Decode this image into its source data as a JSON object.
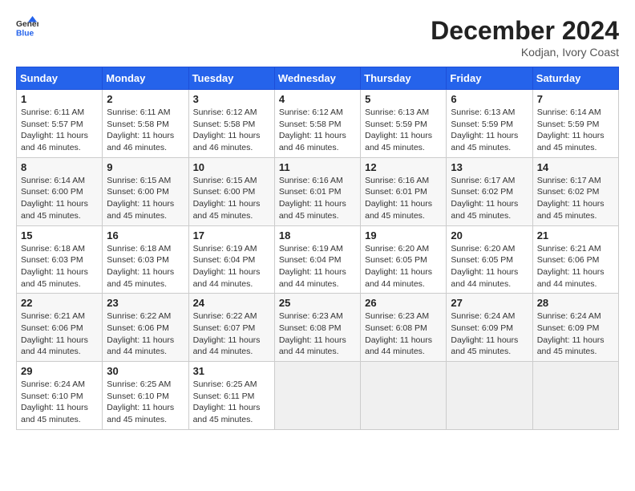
{
  "header": {
    "logo_line1": "General",
    "logo_line2": "Blue",
    "month": "December 2024",
    "location": "Kodjan, Ivory Coast"
  },
  "weekdays": [
    "Sunday",
    "Monday",
    "Tuesday",
    "Wednesday",
    "Thursday",
    "Friday",
    "Saturday"
  ],
  "weeks": [
    [
      {
        "day": "1",
        "info": "Sunrise: 6:11 AM\nSunset: 5:57 PM\nDaylight: 11 hours\nand 46 minutes."
      },
      {
        "day": "2",
        "info": "Sunrise: 6:11 AM\nSunset: 5:58 PM\nDaylight: 11 hours\nand 46 minutes."
      },
      {
        "day": "3",
        "info": "Sunrise: 6:12 AM\nSunset: 5:58 PM\nDaylight: 11 hours\nand 46 minutes."
      },
      {
        "day": "4",
        "info": "Sunrise: 6:12 AM\nSunset: 5:58 PM\nDaylight: 11 hours\nand 46 minutes."
      },
      {
        "day": "5",
        "info": "Sunrise: 6:13 AM\nSunset: 5:59 PM\nDaylight: 11 hours\nand 45 minutes."
      },
      {
        "day": "6",
        "info": "Sunrise: 6:13 AM\nSunset: 5:59 PM\nDaylight: 11 hours\nand 45 minutes."
      },
      {
        "day": "7",
        "info": "Sunrise: 6:14 AM\nSunset: 5:59 PM\nDaylight: 11 hours\nand 45 minutes."
      }
    ],
    [
      {
        "day": "8",
        "info": "Sunrise: 6:14 AM\nSunset: 6:00 PM\nDaylight: 11 hours\nand 45 minutes."
      },
      {
        "day": "9",
        "info": "Sunrise: 6:15 AM\nSunset: 6:00 PM\nDaylight: 11 hours\nand 45 minutes."
      },
      {
        "day": "10",
        "info": "Sunrise: 6:15 AM\nSunset: 6:00 PM\nDaylight: 11 hours\nand 45 minutes."
      },
      {
        "day": "11",
        "info": "Sunrise: 6:16 AM\nSunset: 6:01 PM\nDaylight: 11 hours\nand 45 minutes."
      },
      {
        "day": "12",
        "info": "Sunrise: 6:16 AM\nSunset: 6:01 PM\nDaylight: 11 hours\nand 45 minutes."
      },
      {
        "day": "13",
        "info": "Sunrise: 6:17 AM\nSunset: 6:02 PM\nDaylight: 11 hours\nand 45 minutes."
      },
      {
        "day": "14",
        "info": "Sunrise: 6:17 AM\nSunset: 6:02 PM\nDaylight: 11 hours\nand 45 minutes."
      }
    ],
    [
      {
        "day": "15",
        "info": "Sunrise: 6:18 AM\nSunset: 6:03 PM\nDaylight: 11 hours\nand 45 minutes."
      },
      {
        "day": "16",
        "info": "Sunrise: 6:18 AM\nSunset: 6:03 PM\nDaylight: 11 hours\nand 45 minutes."
      },
      {
        "day": "17",
        "info": "Sunrise: 6:19 AM\nSunset: 6:04 PM\nDaylight: 11 hours\nand 44 minutes."
      },
      {
        "day": "18",
        "info": "Sunrise: 6:19 AM\nSunset: 6:04 PM\nDaylight: 11 hours\nand 44 minutes."
      },
      {
        "day": "19",
        "info": "Sunrise: 6:20 AM\nSunset: 6:05 PM\nDaylight: 11 hours\nand 44 minutes."
      },
      {
        "day": "20",
        "info": "Sunrise: 6:20 AM\nSunset: 6:05 PM\nDaylight: 11 hours\nand 44 minutes."
      },
      {
        "day": "21",
        "info": "Sunrise: 6:21 AM\nSunset: 6:06 PM\nDaylight: 11 hours\nand 44 minutes."
      }
    ],
    [
      {
        "day": "22",
        "info": "Sunrise: 6:21 AM\nSunset: 6:06 PM\nDaylight: 11 hours\nand 44 minutes."
      },
      {
        "day": "23",
        "info": "Sunrise: 6:22 AM\nSunset: 6:06 PM\nDaylight: 11 hours\nand 44 minutes."
      },
      {
        "day": "24",
        "info": "Sunrise: 6:22 AM\nSunset: 6:07 PM\nDaylight: 11 hours\nand 44 minutes."
      },
      {
        "day": "25",
        "info": "Sunrise: 6:23 AM\nSunset: 6:08 PM\nDaylight: 11 hours\nand 44 minutes."
      },
      {
        "day": "26",
        "info": "Sunrise: 6:23 AM\nSunset: 6:08 PM\nDaylight: 11 hours\nand 44 minutes."
      },
      {
        "day": "27",
        "info": "Sunrise: 6:24 AM\nSunset: 6:09 PM\nDaylight: 11 hours\nand 45 minutes."
      },
      {
        "day": "28",
        "info": "Sunrise: 6:24 AM\nSunset: 6:09 PM\nDaylight: 11 hours\nand 45 minutes."
      }
    ],
    [
      {
        "day": "29",
        "info": "Sunrise: 6:24 AM\nSunset: 6:10 PM\nDaylight: 11 hours\nand 45 minutes."
      },
      {
        "day": "30",
        "info": "Sunrise: 6:25 AM\nSunset: 6:10 PM\nDaylight: 11 hours\nand 45 minutes."
      },
      {
        "day": "31",
        "info": "Sunrise: 6:25 AM\nSunset: 6:11 PM\nDaylight: 11 hours\nand 45 minutes."
      },
      null,
      null,
      null,
      null
    ]
  ]
}
